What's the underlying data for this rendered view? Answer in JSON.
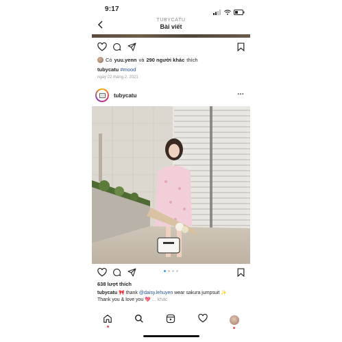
{
  "status": {
    "time": "9:17"
  },
  "header": {
    "username": "TUBYCATU",
    "title": "Bài viết"
  },
  "prev_post": {
    "liked_by_user": "yuu.yenn",
    "likes_prefix": "Có",
    "likes_and": "và",
    "likes_others": "290 người khác",
    "likes_suffix": "thích",
    "caption_user": "tubycatu",
    "caption_tag": "#mood",
    "date": "ngày 22 tháng 2, 2021"
  },
  "post": {
    "username": "tubycatu",
    "more_icon": "⋯",
    "likes": "638 lượt thích",
    "caption_user": "tubycatu",
    "caption_text_1": "thank",
    "caption_mention": "@daisy.lehuyen",
    "caption_text_2": "wear sakura jumpsuit",
    "caption_line2": "Thank you & love you",
    "caption_more": "... khác",
    "carousel": {
      "count": 4,
      "active": 1
    }
  },
  "nav": {
    "items": [
      {
        "icon": "home-icon"
      },
      {
        "icon": "search-icon"
      },
      {
        "icon": "reels-icon"
      },
      {
        "icon": "heart-icon"
      },
      {
        "icon": "profile-avatar"
      }
    ]
  },
  "colors": {
    "accent": "#3897f0",
    "link": "#1f4f8f",
    "notification": "#ed4956"
  }
}
